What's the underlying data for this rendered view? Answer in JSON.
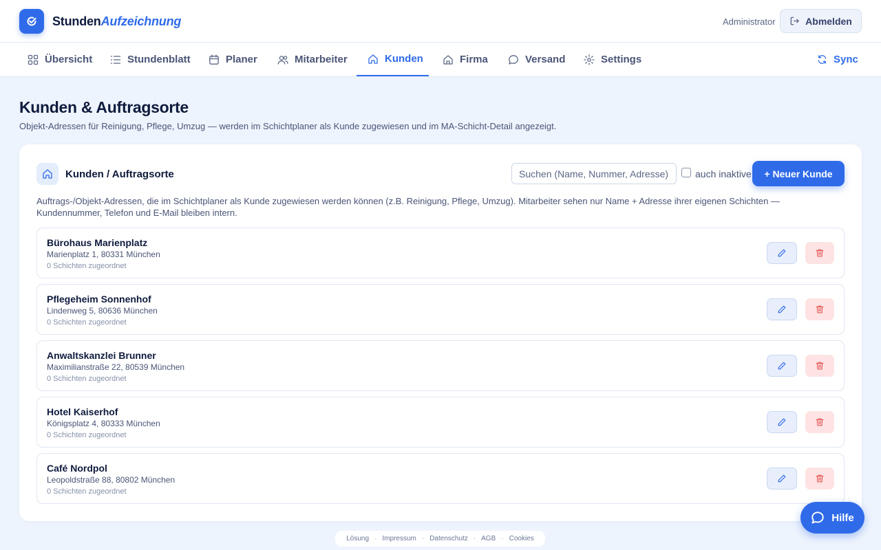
{
  "app": {
    "brand_part1": "Stunden",
    "brand_part2": "Aufzeichnung",
    "user": "Administrator",
    "logout_label": "Abmelden"
  },
  "nav": {
    "items": [
      {
        "label": "Übersicht",
        "icon": "grid-icon"
      },
      {
        "label": "Stundenblatt",
        "icon": "list-icon"
      },
      {
        "label": "Planer",
        "icon": "calendar-icon"
      },
      {
        "label": "Mitarbeiter",
        "icon": "users-icon"
      },
      {
        "label": "Kunden",
        "icon": "home-icon",
        "active": true
      },
      {
        "label": "Firma",
        "icon": "building-icon"
      },
      {
        "label": "Versand",
        "icon": "chat-icon"
      },
      {
        "label": "Settings",
        "icon": "gear-icon"
      }
    ],
    "sync_label": "Sync"
  },
  "page": {
    "title": "Kunden & Auftragsorte",
    "subtitle": "Objekt-Adressen für Reinigung, Pflege, Umzug — werden im Schichtplaner als Kunde zugewiesen und im MA-Schicht-Detail angezeigt."
  },
  "card": {
    "title": "Kunden / Auftragsorte",
    "search_placeholder": "Suchen (Name, Nummer, Adresse)",
    "inactive_label": "auch inaktive",
    "new_button": "+ Neuer Kunde",
    "description": "Auftrags-/Objekt-Adressen, die im Schichtplaner als Kunde zugewiesen werden können (z.B. Reinigung, Pflege, Umzug). Mitarbeiter sehen nur Name + Adresse ihrer eigenen Schichten — Kundennummer, Telefon und E-Mail bleiben intern."
  },
  "customers": [
    {
      "name": "Bürohaus Marienplatz",
      "address": "Marienplatz 1, 80331 München",
      "shifts": "0 Schichten zugeordnet"
    },
    {
      "name": "Pflegeheim Sonnenhof",
      "address": "Lindenweg 5, 80636 München",
      "shifts": "0 Schichten zugeordnet"
    },
    {
      "name": "Anwaltskanzlei Brunner",
      "address": "Maximilianstraße 22, 80539 München",
      "shifts": "0 Schichten zugeordnet"
    },
    {
      "name": "Hotel Kaiserhof",
      "address": "Königsplatz 4, 80333 München",
      "shifts": "0 Schichten zugeordnet"
    },
    {
      "name": "Café Nordpol",
      "address": "Leopoldstraße 88, 80802 München",
      "shifts": "0 Schichten zugeordnet"
    }
  ],
  "help_label": "Hilfe",
  "footer": {
    "links": [
      "Lösung",
      "Impressum",
      "Datenschutz",
      "AGB",
      "Cookies"
    ]
  },
  "colors": {
    "accent": "#2f6be9",
    "danger": "#e45858",
    "background": "#eef4fd"
  }
}
